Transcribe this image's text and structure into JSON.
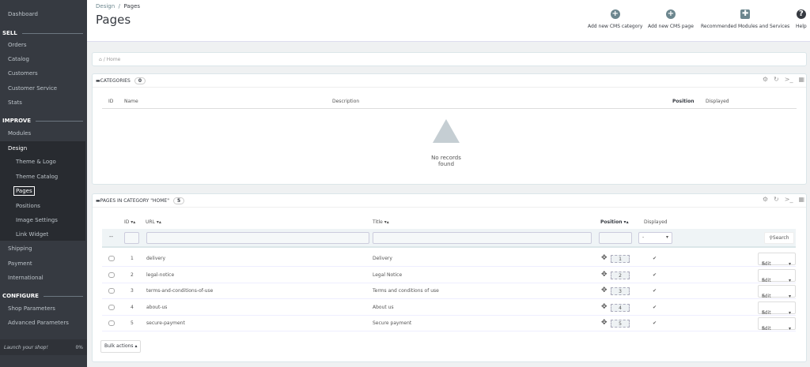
{
  "sidebar": {
    "dashboard": "Dashboard",
    "sell": "SELL",
    "orders": "Orders",
    "catalog": "Catalog",
    "customers": "Customers",
    "customer_service": "Customer Service",
    "stats": "Stats",
    "improve": "IMPROVE",
    "modules": "Modules",
    "design": "Design",
    "design_sub": [
      "Theme & Logo",
      "Theme Catalog",
      "Pages",
      "Positions",
      "Image Settings",
      "Link Widget"
    ],
    "shipping": "Shipping",
    "payment": "Payment",
    "international": "International",
    "configure": "CONFIGURE",
    "shop_parameters": "Shop Parameters",
    "advanced_parameters": "Advanced Parameters",
    "launch": "Launch your shop!",
    "launch_pct": "0%"
  },
  "header": {
    "breadcrumb": [
      "Design",
      "Pages"
    ],
    "title": "Pages",
    "toolbar": [
      {
        "label": "Add new CMS category",
        "icon": "plus-circle-icon"
      },
      {
        "label": "Add new CMS page",
        "icon": "plus-circle-icon"
      },
      {
        "label": "Recommended Modules and Services",
        "icon": "puzzle-icon"
      },
      {
        "label": "Help",
        "icon": "help-icon"
      }
    ]
  },
  "home_breadcrumb": "Home",
  "categories": {
    "title": "CATEGORIES",
    "count": "0",
    "columns": [
      "ID",
      "Name",
      "Description",
      "Position",
      "Displayed"
    ],
    "empty": "No records found"
  },
  "pages": {
    "title": "PAGES IN CATEGORY \"HOME\"",
    "count": "5",
    "columns": {
      "id": "ID",
      "url": "URL",
      "title": "Title",
      "position": "Position",
      "displayed": "Displayed"
    },
    "filter_select": "-",
    "search": "Search",
    "edit": "Edit",
    "bulk": "Bulk actions",
    "rows": [
      {
        "id": "1",
        "url": "delivery",
        "title": "Delivery",
        "position": "1"
      },
      {
        "id": "2",
        "url": "legal-notice",
        "title": "Legal Notice",
        "position": "2"
      },
      {
        "id": "3",
        "url": "terms-and-conditions-of-use",
        "title": "Terms and conditions of use",
        "position": "3"
      },
      {
        "id": "4",
        "url": "about-us",
        "title": "About us",
        "position": "4"
      },
      {
        "id": "5",
        "url": "secure-payment",
        "title": "Secure payment",
        "position": "5"
      }
    ]
  }
}
